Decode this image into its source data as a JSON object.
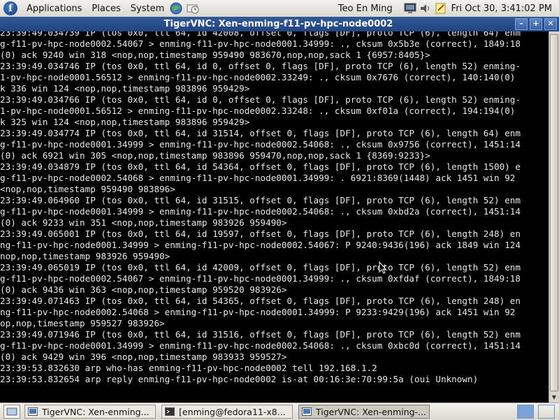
{
  "panel": {
    "menus": [
      "Applications",
      "Places",
      "System"
    ],
    "user": "Teo En Ming",
    "clock": "Fri Oct 30,  3:41:02 PM"
  },
  "window": {
    "title": "TigerVNC: Xen-enming-f11-pv-hpc-node0002"
  },
  "terminal": {
    "lines": [
      "23:39:49.034739 IP (tos 0x0, ttl 64, id 42008, offset 0, flags [DF], proto TCP (6), length 64) enm",
      "g-f11-pv-hpc-node0002.54067 > enming-f11-pv-hpc-node0001.34999: ., cksum 0x5b3e (correct), 1849:18",
      "(0) ack 9240 win 318 <nop,nop,timestamp 959490 983670,nop,nop,sack 1 {6957:8405}>",
      "23:39:49.034746 IP (tos 0x0, ttl 64, id 0, offset 0, flags [DF], proto TCP (6), length 52) enming-",
      "1-pv-hpc-node0001.56512 > enming-f11-pv-hpc-node0002.33249: ., cksum 0x7676 (correct), 140:140(0)",
      "k 336 win 124 <nop,nop,timestamp 983896 959429>",
      "23:39:49.034766 IP (tos 0x0, ttl 64, id 0, offset 0, flags [DF], proto TCP (6), length 52) enming-",
      "1-pv-hpc-node0001.56512 > enming-f11-pv-hpc-node0002.33248: ., cksum 0xf01a (correct), 194:194(0)",
      "k 325 win 124 <nop,nop,timestamp 983896 959429>",
      "23:39:49.034774 IP (tos 0x0, ttl 64, id 31514, offset 0, flags [DF], proto TCP (6), length 64) enm",
      "g-f11-pv-hpc-node0001.34999 > enming-f11-pv-hpc-node0002.54068: ., cksum 0x9756 (correct), 1451:14",
      "(0) ack 6921 win 305 <nop,nop,timestamp 983896 959470,nop,nop,sack 1 {8369:9233}>",
      "23:39:49.034879 IP (tos 0x0, ttl 64, id 54364, offset 0, flags [DF], proto TCP (6), length 1500) e",
      "g-f11-pv-hpc-node0002.54068 > enming-f11-pv-hpc-node0001.34999: . 6921:8369(1448) ack 1451 win 92",
      "<nop,nop,timestamp 959490 983896>",
      "23:39:49.064960 IP (tos 0x0, ttl 64, id 31515, offset 0, flags [DF], proto TCP (6), length 52) enm",
      "g-f11-pv-hpc-node0001.34999 > enming-f11-pv-hpc-node0002.54068: ., cksum 0xbd2a (correct), 1451:14",
      "(0) ack 9233 win 351 <nop,nop,timestamp 983926 959490>",
      "23:39:49.065001 IP (tos 0x0, ttl 64, id 19597, offset 0, flags [DF], proto TCP (6), length 248) en",
      "ng-f11-pv-hpc-node0001.34999 > enming-f11-pv-hpc-node0002.54067: P 9240:9436(196) ack 1849 win 124",
      "nop,nop,timestamp 983926 959490>",
      "23:39:49.065019 IP (tos 0x0, ttl 64, id 42009, offset 0, flags [DF], proto TCP (6), length 52) enm",
      "g-f11-pv-hpc-node0002.54067 > enming-f11-pv-hpc-node0001.34999: ., cksum 0xfdaf (correct), 1849:18",
      "(0) ack 9436 win 363 <nop,nop,timestamp 959520 983926>",
      "23:39:49.071463 IP (tos 0x0, ttl 64, id 54365, offset 0, flags [DF], proto TCP (6), length 248) en",
      "ng-f11-pv-hpc-node0002.54068 > enming-f11-pv-hpc-node0001.34999: P 9233:9429(196) ack 1451 win 92",
      "op,nop,timestamp 959527 983926>",
      "23:39:49.071946 IP (tos 0x0, ttl 64, id 31516, offset 0, flags [DF], proto TCP (6), length 52) enm",
      "g-f11-pv-hpc-node0001.34999 > enming-f11-pv-hpc-node0002.54068: ., cksum 0xbc0d (correct), 1451:14",
      "(0) ack 9429 win 396 <nop,nop,timestamp 983933 959527>",
      "23:39:53.832630 arp who-has enming-f11-pv-hpc-node0002 tell 192.168.1.2",
      "23:39:53.832654 arp reply enming-f11-pv-hpc-node0002 is-at 00:16:3e:70:99:5a (oui Unknown)",
      "",
      "_"
    ]
  },
  "taskbar": {
    "tasks": [
      "TigerVNC: Xen-enming...",
      "[enming@fedora11-x8...",
      "TigerVNC: Xen-enming-..."
    ]
  },
  "colors": {
    "panel_bg": "#e6e3dc",
    "titlebar_bg": "#2a4f8d",
    "terminal_bg": "#000000",
    "terminal_fg": "#e8e8e8"
  }
}
